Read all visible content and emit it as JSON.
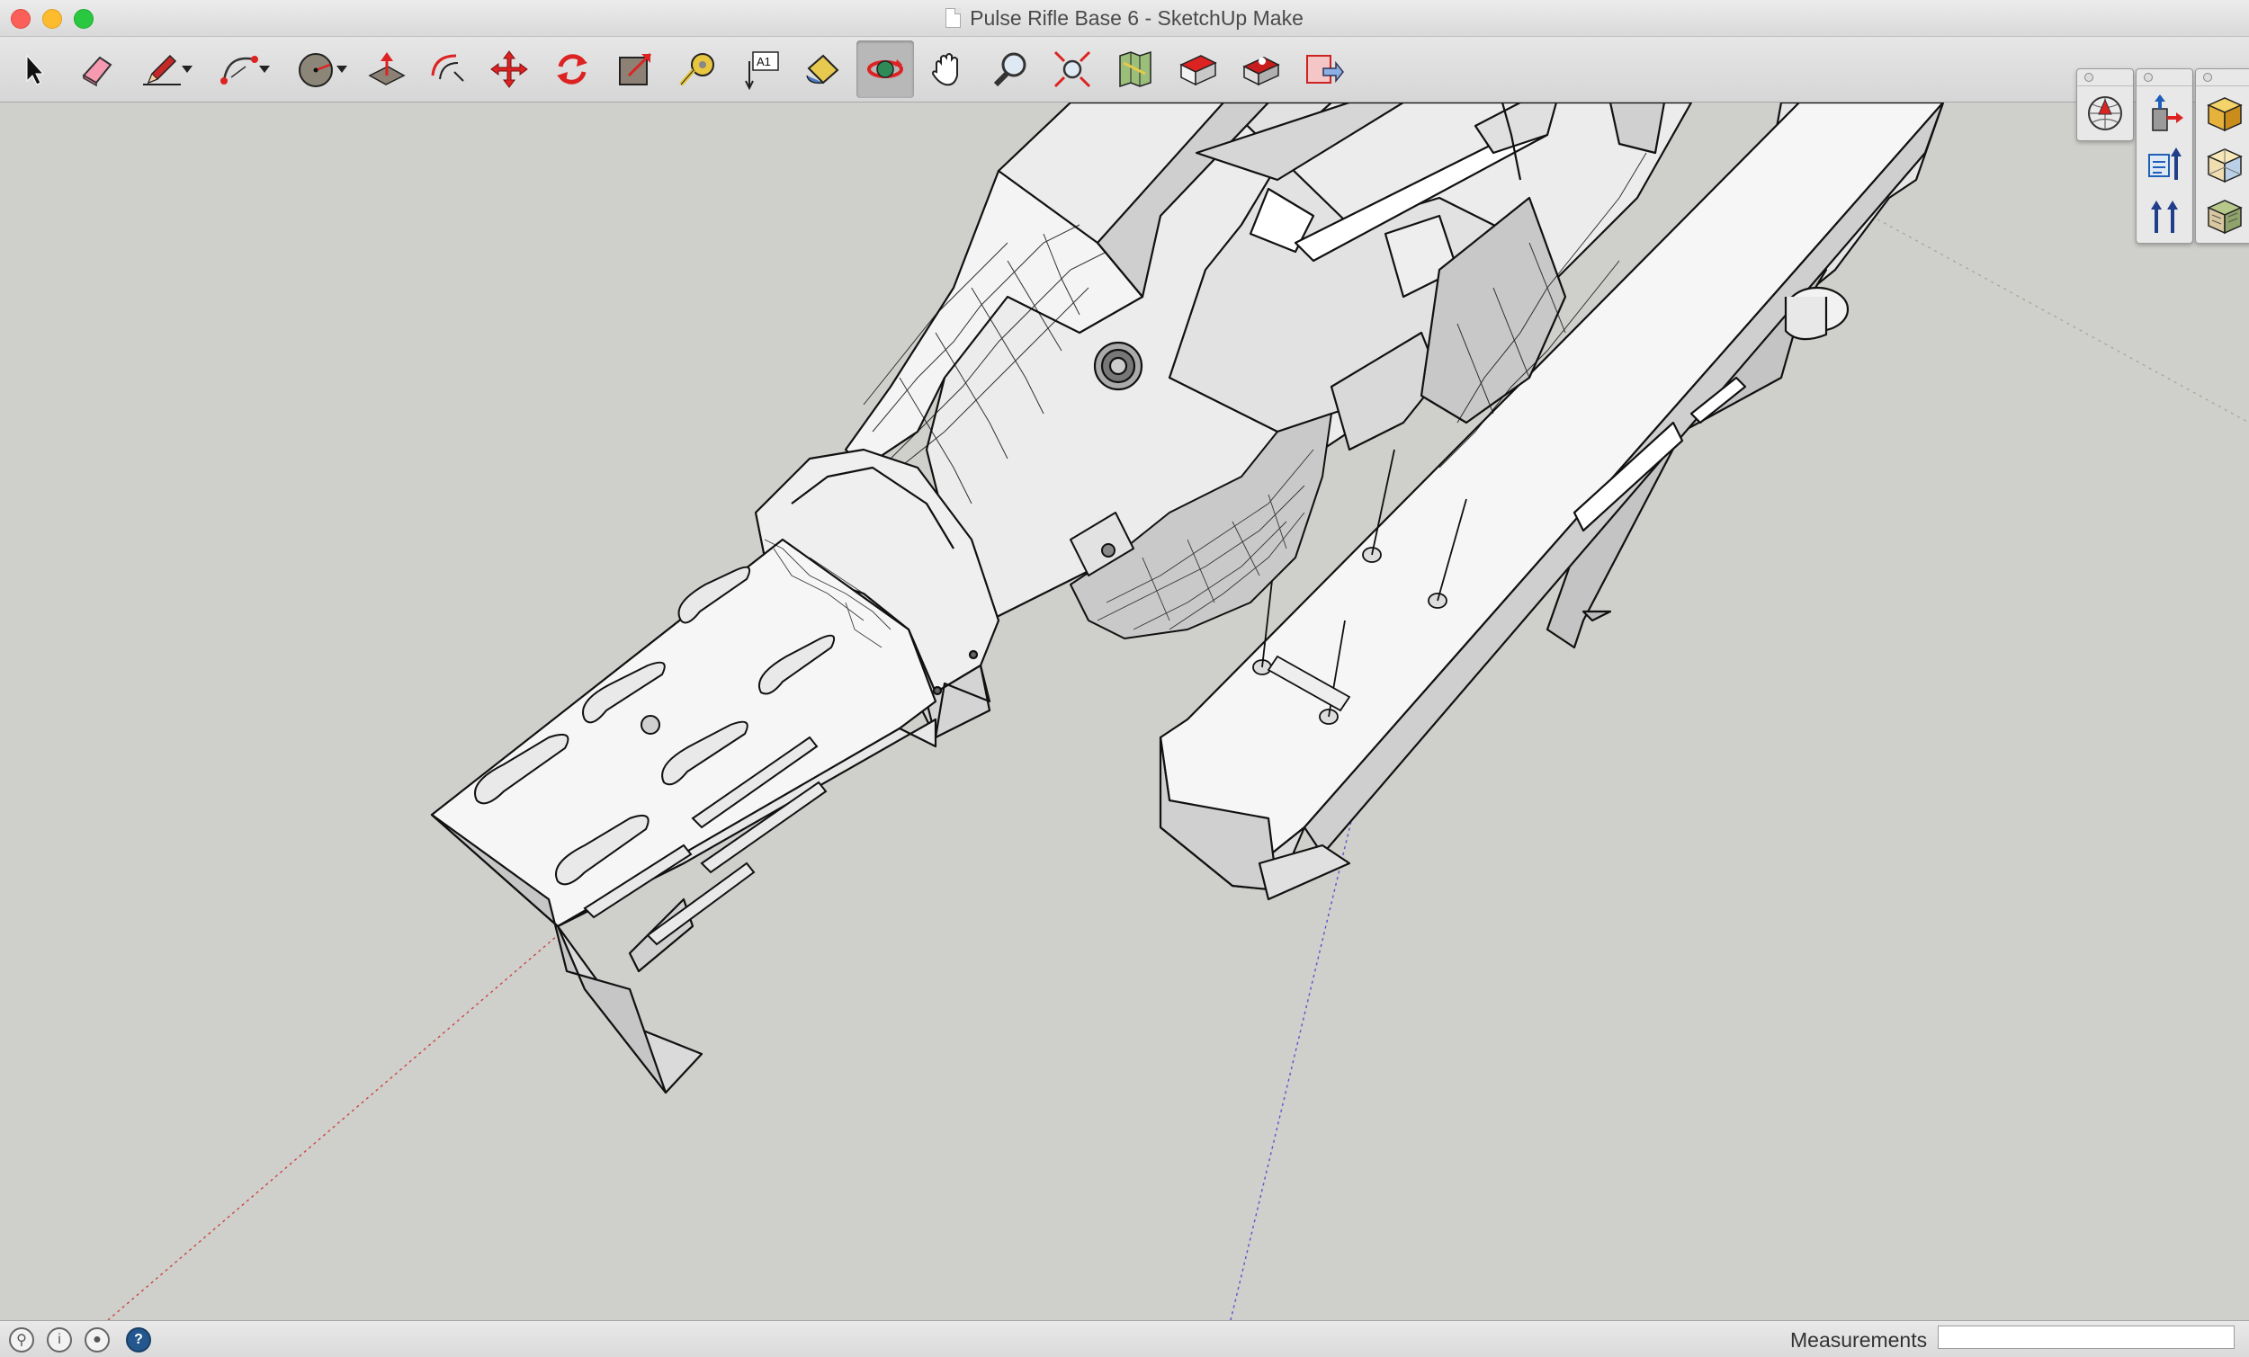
{
  "window": {
    "title": "Pulse Rifle Base 6 - SketchUp Make",
    "controls": [
      "close-button",
      "minimize-button",
      "zoom-button"
    ]
  },
  "toolbar": {
    "tools": [
      {
        "name": "select-tool",
        "icon": "arrow-cursor-icon"
      },
      {
        "name": "eraser-tool",
        "icon": "eraser-icon"
      },
      {
        "name": "line-tool",
        "icon": "pencil-icon",
        "has_dropdown": true
      },
      {
        "name": "arc-tool",
        "icon": "arc-icon",
        "has_dropdown": true
      },
      {
        "name": "shape-tool",
        "icon": "circle-shape-icon",
        "has_dropdown": true
      },
      {
        "name": "push-pull-tool",
        "icon": "push-pull-icon"
      },
      {
        "name": "offset-tool",
        "icon": "offset-icon"
      },
      {
        "name": "move-tool",
        "icon": "move-arrows-icon"
      },
      {
        "name": "rotate-tool",
        "icon": "rotate-icon"
      },
      {
        "name": "scale-tool",
        "icon": "scale-icon"
      },
      {
        "name": "tape-measure-tool",
        "icon": "tape-measure-icon"
      },
      {
        "name": "text-tool",
        "icon": "text-icon",
        "label": "A1"
      },
      {
        "name": "paint-bucket-tool",
        "icon": "paint-bucket-icon"
      },
      {
        "name": "orbit-tool",
        "icon": "orbit-icon",
        "active": true
      },
      {
        "name": "pan-tool",
        "icon": "hand-icon"
      },
      {
        "name": "zoom-tool",
        "icon": "magnifier-icon"
      },
      {
        "name": "zoom-extents-tool",
        "icon": "zoom-extents-icon"
      },
      {
        "name": "add-location-tool",
        "icon": "map-icon"
      },
      {
        "name": "3d-warehouse-tool",
        "icon": "warehouse-icon"
      },
      {
        "name": "extension-warehouse-tool",
        "icon": "extension-warehouse-icon"
      },
      {
        "name": "send-to-layout-tool",
        "icon": "layout-icon"
      }
    ]
  },
  "palettes": [
    {
      "name": "palette-1",
      "buttons": [
        "globe-icon"
      ]
    },
    {
      "name": "palette-2",
      "buttons": [
        "push-up-icon",
        "text-arrow-icon",
        "vertical-arrows-icon"
      ]
    },
    {
      "name": "palette-3",
      "buttons": [
        "solid-box-icon",
        "xray-box-icon",
        "textured-box-icon"
      ]
    }
  ],
  "status": {
    "icons": [
      "geo-location-icon",
      "credits-icon",
      "user-icon",
      "help-icon"
    ],
    "measurements_label": "Measurements",
    "measurements_value": ""
  },
  "colors": {
    "viewport_bg": "#cfcfcb",
    "model_face": "#f4f4f4",
    "model_shade": "#bfbfbf",
    "edge": "#000000",
    "active_tool_bg": "#b8b8b8"
  }
}
